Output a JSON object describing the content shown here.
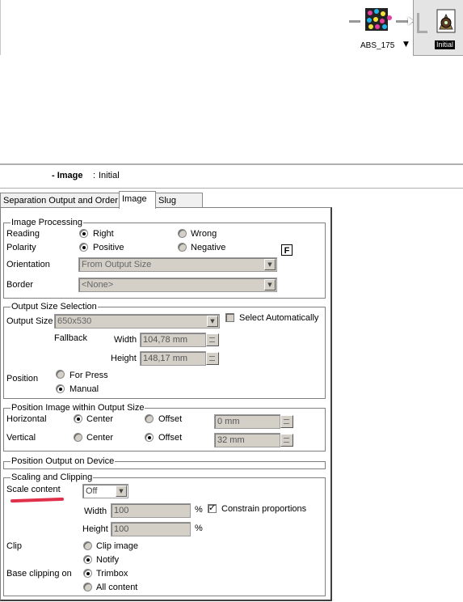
{
  "workflow": {
    "node1_label": "ABS_175",
    "node2_label": "Initial",
    "node1_icon": "color-separation-icon",
    "node2_icon": "image-gear-icon"
  },
  "header": {
    "prefix": "- Image",
    "separator": ":",
    "value": "Initial"
  },
  "tabs": [
    "Separation Output and Order",
    "Image",
    "Slug Lines"
  ],
  "image_processing": {
    "legend": "Image Processing",
    "reading_label": "Reading",
    "reading_right": "Right",
    "reading_wrong": "Wrong",
    "polarity_label": "Polarity",
    "polarity_positive": "Positive",
    "polarity_negative": "Negative",
    "f_badge": "F",
    "orientation_label": "Orientation",
    "orientation_value": "From Output Size",
    "border_label": "Border",
    "border_value": "<None>"
  },
  "output_size": {
    "legend": "Output Size Selection",
    "size_label": "Output Size",
    "size_value": "650x530",
    "select_auto": "Select Automatically",
    "fallback_label": "Fallback",
    "width_label": "Width",
    "width_value": "104,78 mm",
    "height_label": "Height",
    "height_value": "148,17 mm",
    "position_label": "Position",
    "for_press": "For Press",
    "manual": "Manual"
  },
  "position_image": {
    "legend": "Position Image within Output Size",
    "horizontal_label": "Horizontal",
    "vertical_label": "Vertical",
    "center": "Center",
    "offset": "Offset",
    "h_offset_value": "0 mm",
    "v_offset_value": "32 mm"
  },
  "position_device": {
    "legend": "Position Output on Device"
  },
  "scaling": {
    "legend": "Scaling and Clipping",
    "scale_content_label": "Scale content",
    "scale_content_value": "Off",
    "width_label": "Width",
    "width_value": "100",
    "height_label": "Height",
    "height_value": "100",
    "percent": "%",
    "constrain": "Constrain proportions",
    "clip_label": "Clip",
    "clip_image": "Clip image",
    "notify": "Notify",
    "base_clipping_label": "Base clipping on",
    "trimbox": "Trimbox",
    "all_content": "All content"
  },
  "colors": {
    "annotation_underline": "#e0304a"
  }
}
